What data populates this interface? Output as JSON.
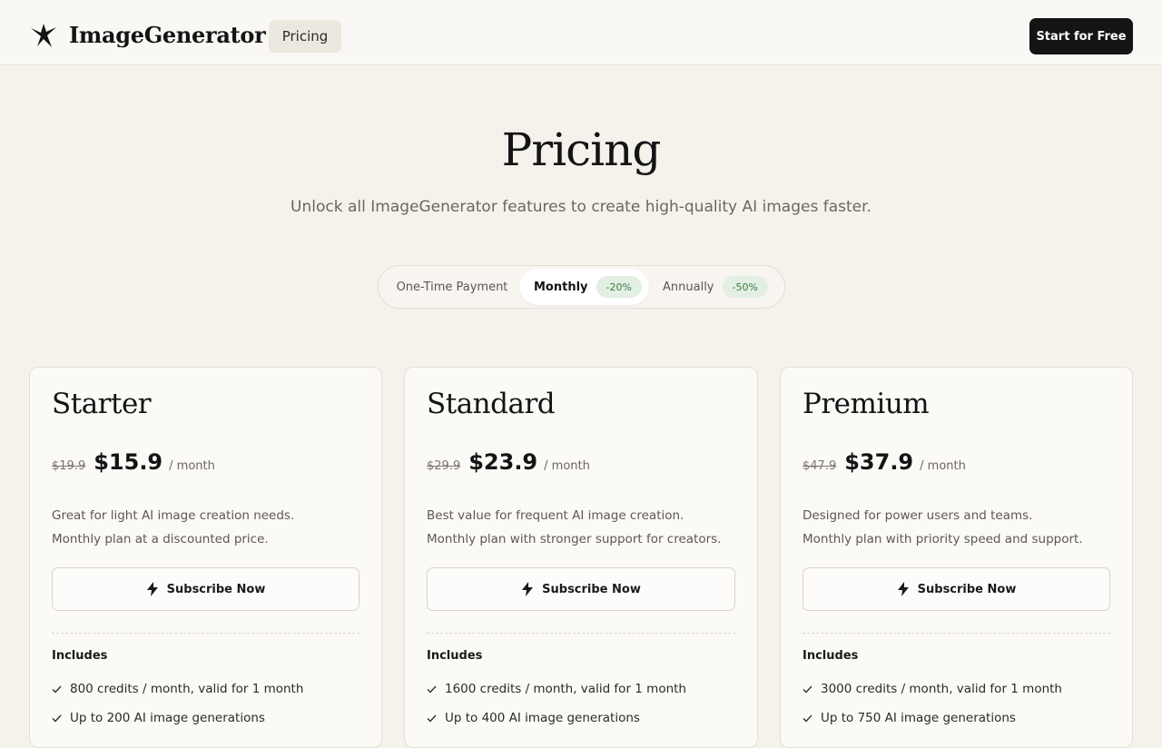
{
  "header": {
    "logo_text": "ImageGenerator",
    "nav_pricing": "Pricing",
    "cta": "Start for Free"
  },
  "hero": {
    "title": "Pricing",
    "subtitle": "Unlock all ImageGenerator features to create high-quality AI images faster."
  },
  "billing_toggle": {
    "one_time": "One-Time Payment",
    "monthly": "Monthly",
    "monthly_badge": "-20%",
    "annually": "Annually",
    "annually_badge": "-50%",
    "selected": "Monthly"
  },
  "plans": [
    {
      "name": "Starter",
      "old_price": "$19.9",
      "price": "$15.9",
      "period": "/ month",
      "desc1": "Great for light AI image creation needs.",
      "desc2": "Monthly plan at a discounted price.",
      "button": "Subscribe Now",
      "includes_label": "Includes",
      "features": [
        "800 credits / month, valid for 1 month",
        "Up to 200 AI image generations"
      ]
    },
    {
      "name": "Standard",
      "old_price": "$29.9",
      "price": "$23.9",
      "period": "/ month",
      "desc1": "Best value for frequent AI image creation.",
      "desc2": "Monthly plan with stronger support for creators.",
      "button": "Subscribe Now",
      "includes_label": "Includes",
      "features": [
        "1600 credits / month, valid for 1 month",
        "Up to 400 AI image generations"
      ]
    },
    {
      "name": "Premium",
      "old_price": "$47.9",
      "price": "$37.9",
      "period": "/ month",
      "desc1": "Designed for power users and teams.",
      "desc2": "Monthly plan with priority speed and support.",
      "button": "Subscribe Now",
      "includes_label": "Includes",
      "features": [
        "3000 credits / month, valid for 1 month",
        "Up to 750 AI image generations"
      ]
    }
  ],
  "icons": {
    "logo": "bird-logo-icon",
    "subscribe": "lightning-icon",
    "feature": "check-icon"
  },
  "colors": {
    "background": "#f5f2ec",
    "cta": "#141414",
    "badge_bg": "#e2efe2",
    "badge_text": "#3f7a47"
  }
}
